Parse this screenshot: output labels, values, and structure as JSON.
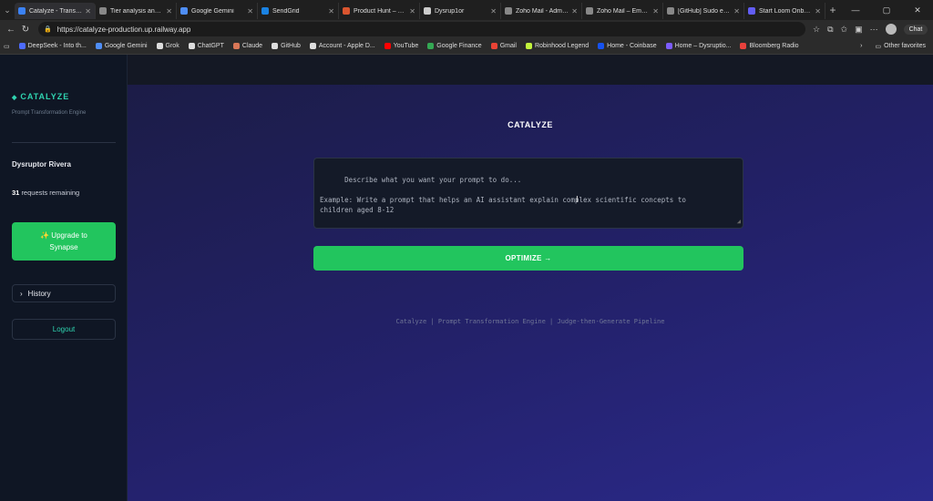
{
  "browser": {
    "tabs": [
      {
        "title": "Catalyze - Transform",
        "color": "#3b82f6",
        "active": true
      },
      {
        "title": "Tier analysis and rec",
        "color": "#888888"
      },
      {
        "title": "Google Gemini",
        "color": "#4f8ef7"
      },
      {
        "title": "SendGrid",
        "color": "#1a82e2"
      },
      {
        "title": "Product Hunt – The b",
        "color": "#da552f"
      },
      {
        "title": "Dysrup1or",
        "color": "#cccccc"
      },
      {
        "title": "Zoho Mail - Admin C",
        "color": "#888888"
      },
      {
        "title": "Zoho Mail – Email Se",
        "color": "#888888"
      },
      {
        "title": "[GitHub] Sudo email",
        "color": "#888888"
      },
      {
        "title": "Start Loom Onboardi",
        "color": "#625df5"
      }
    ],
    "url": "https://catalyze-production.up.railway.app",
    "chat_label": "Chat",
    "bookmarks": [
      {
        "label": "DeepSeek - Into th...",
        "color": "#4d6bfe"
      },
      {
        "label": "Google Gemini",
        "color": "#4f8ef7"
      },
      {
        "label": "Grok",
        "color": "#dddddd"
      },
      {
        "label": "ChatGPT",
        "color": "#dddddd"
      },
      {
        "label": "Claude",
        "color": "#d97757"
      },
      {
        "label": "GitHub",
        "color": "#dddddd"
      },
      {
        "label": "Account - Apple D...",
        "color": "#dddddd"
      },
      {
        "label": "YouTube",
        "color": "#ff0000"
      },
      {
        "label": "Google Finance",
        "color": "#34a853"
      },
      {
        "label": "Gmail",
        "color": "#ea4335"
      },
      {
        "label": "Robinhood Legend",
        "color": "#c3f53c"
      },
      {
        "label": "Home - Coinbase",
        "color": "#1652f0"
      },
      {
        "label": "Home – Dysruptio...",
        "color": "#7c5cff"
      },
      {
        "label": "Bloomberg Radio",
        "color": "#e8413c"
      }
    ],
    "other_favorites": "Other favorites"
  },
  "sidebar": {
    "brand": "CATALYZE",
    "brand_sub": "Prompt Transformation Engine",
    "user_name": "Dysruptor Rivera",
    "requests_count": "31",
    "requests_text": "requests remaining",
    "upgrade_line1": "✨ Upgrade to",
    "upgrade_line2": "Synapse",
    "history_label": "History",
    "logout_label": "Logout"
  },
  "main": {
    "title": "CATALYZE",
    "prompt_placeholder": "Describe what you want your prompt to do...\n\nExample: Write a prompt that helps an AI assistant explain complex scientific concepts to\nchildren aged 8-12",
    "optimize_label": "OPTIMIZE →",
    "footer": "Catalyze | Prompt Transformation Engine | Judge-then-Generate Pipeline"
  }
}
